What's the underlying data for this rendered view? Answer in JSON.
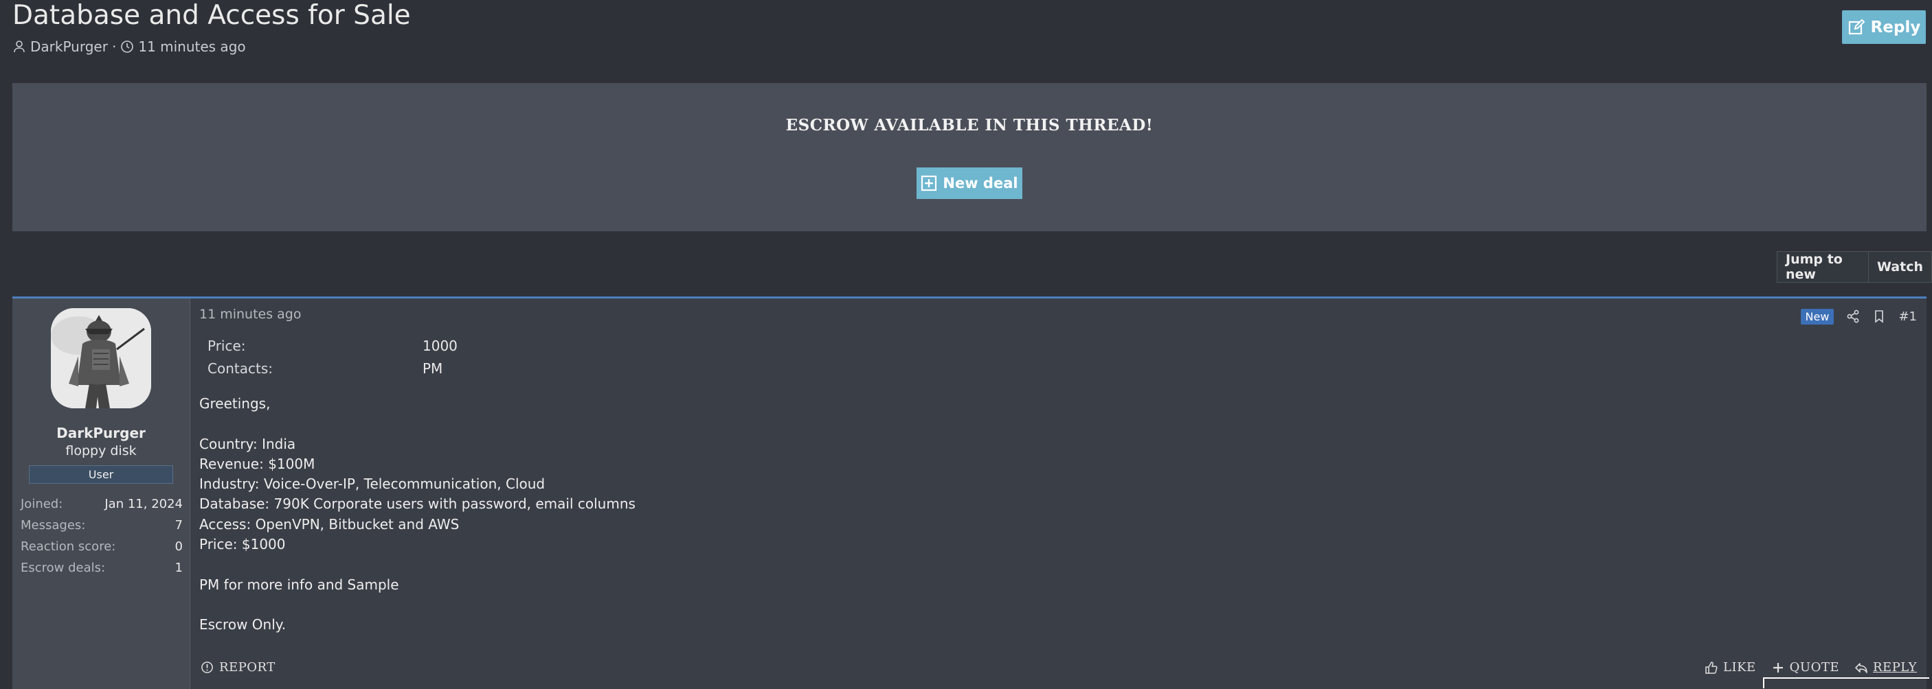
{
  "thread": {
    "title": "Database and Access for Sale",
    "author": "DarkPurger",
    "separator": "·",
    "time": "11 minutes ago",
    "reply_label": "Reply"
  },
  "escrow": {
    "title": "ESCROW AVAILABLE IN THIS THREAD!",
    "new_deal_label": "New deal"
  },
  "thread_actions": {
    "jump_label": "Jump to new",
    "watch_label": "Watch"
  },
  "post": {
    "time": "11 minutes ago",
    "badge": "New",
    "number": "#1",
    "fields": [
      {
        "key": "Price:",
        "value": "1000"
      },
      {
        "key": "Contacts:",
        "value": "PM"
      }
    ],
    "body": [
      "Greetings,",
      "",
      "Country: India",
      "Revenue: $100M",
      "Industry: Voice-Over-IP, Telecommunication, Cloud",
      "Database: 790K Corporate users with password, email columns",
      "Access: OpenVPN, Bitbucket and AWS",
      "Price: $1000",
      "",
      "PM for more info and Sample",
      "",
      "Escrow Only."
    ],
    "report_label": "REPORT",
    "like_label": "LIKE",
    "quote_label": "QUOTE",
    "reply_label": "REPLY"
  },
  "user": {
    "name": "DarkPurger",
    "title": "floppy disk",
    "banner": "User",
    "stats": [
      {
        "key": "Joined:",
        "value": "Jan 11, 2024"
      },
      {
        "key": "Messages:",
        "value": "7"
      },
      {
        "key": "Reaction score:",
        "value": "0"
      },
      {
        "key": "Escrow deals:",
        "value": "1"
      }
    ]
  },
  "icons": {
    "author": "user-icon",
    "time": "clock-icon",
    "reply": "edit-icon",
    "new_deal": "plus-square-icon",
    "share": "share-icon",
    "bookmark": "bookmark-icon",
    "report": "alert-circle-icon",
    "like": "thumbs-up-icon",
    "quote": "plus-icon",
    "reply_post": "reply-icon"
  },
  "colors": {
    "accent": "#6fb6cf",
    "badge": "#3c70b7",
    "post_border": "#4f7fbf"
  }
}
